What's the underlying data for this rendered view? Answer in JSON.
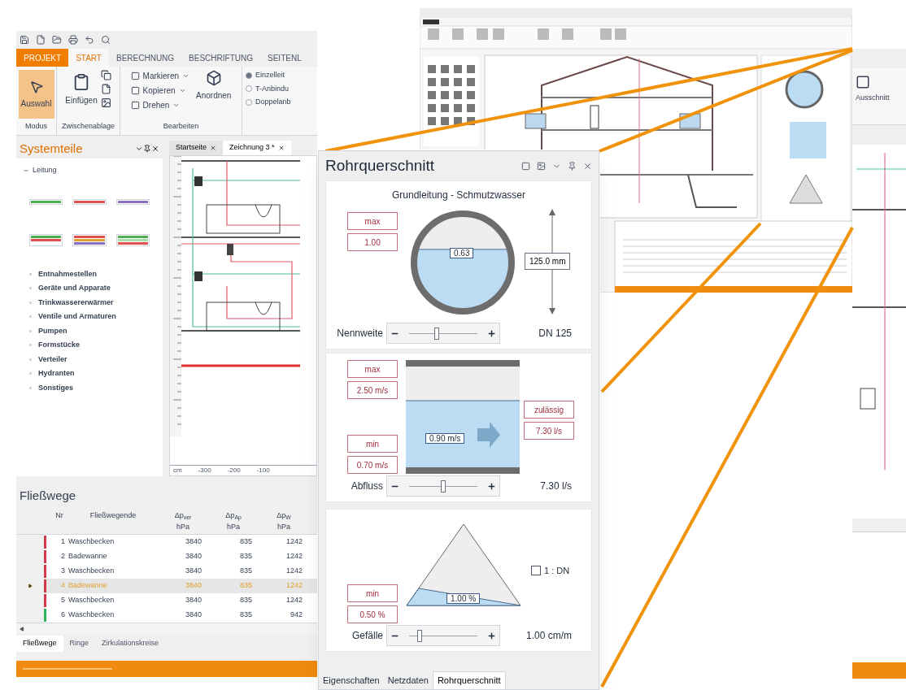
{
  "left_window": {
    "ribbon_tabs": [
      {
        "label": "PROJEKT",
        "kind": "file",
        "selected": false
      },
      {
        "label": "START",
        "kind": "tab",
        "selected": true
      },
      {
        "label": "BERECHNUNG",
        "kind": "tab",
        "selected": false
      },
      {
        "label": "BESCHRIFTUNG",
        "kind": "tab",
        "selected": false
      },
      {
        "label": "SEITENL",
        "kind": "tab",
        "selected": false
      }
    ],
    "modus": {
      "group": "Modus",
      "button": "Auswahl",
      "selected": true
    },
    "clipboard": {
      "group": "Zwischenablage",
      "button": "Einfügen"
    },
    "edit": {
      "group": "Bearbeiten",
      "items": [
        "Markieren",
        "Kopieren",
        "Drehen"
      ],
      "arrange": "Anordnen"
    },
    "connections": [
      {
        "label": "Einzelleit",
        "selected": true
      },
      {
        "label": "T-Anbindu",
        "selected": false
      },
      {
        "label": "Doppelanb",
        "selected": false
      }
    ],
    "sidebar": {
      "title": "Systemteile",
      "root": {
        "label": "Leitung",
        "expanded": true
      },
      "pipe_swatches": [
        {
          "stripes": [
            {
              "color": "#4caf50"
            }
          ]
        },
        {
          "stripes": [
            {
              "color": "#e05050"
            }
          ]
        },
        {
          "stripes": [
            {
              "color": "#8a6fc0"
            }
          ]
        },
        {
          "stripes": [
            {
              "color": "#4caf50"
            },
            {
              "color": "#e05050"
            }
          ]
        },
        {
          "stripes": [
            {
              "color": "#e05050"
            },
            {
              "color": "#e0a030"
            },
            {
              "color": "#8a6fc0"
            }
          ]
        },
        {
          "stripes": [
            {
              "color": "#4caf50"
            },
            {
              "color": "#a8e0a8"
            },
            {
              "color": "#e05050"
            }
          ]
        }
      ],
      "categories": [
        "Entnahmestellen",
        "Geräte und Apparate",
        "Trinkwassererwärmer",
        "Ventile und Armaturen",
        "Pumpen",
        "Formstücke",
        "Verteiler",
        "Hydranten",
        "Sonstiges"
      ]
    },
    "doc_tabs": [
      {
        "label": "Startseite",
        "selected": false
      },
      {
        "label": "Zeichnung 3 *",
        "selected": true
      }
    ],
    "ruler": {
      "unit": "cm",
      "labels": [
        "-300",
        "-200",
        "-100"
      ]
    },
    "table": {
      "title": "Fließwege",
      "columns": [
        {
          "name": "Nr"
        },
        {
          "name": "Fließwegende"
        },
        {
          "name": "Δp$_{ver}$",
          "unit": "hPa"
        },
        {
          "name": "Δp$_{Ap}$",
          "unit": "hPa"
        },
        {
          "name": "Δp$_{W}$",
          "unit": "hPa"
        }
      ],
      "rows": [
        {
          "cells": [
            "1",
            "Waschbecken",
            "3840",
            "835",
            "1242"
          ],
          "color": "#d0384c",
          "selected": false
        },
        {
          "cells": [
            "2",
            "Badewanne",
            "3840",
            "835",
            "1242"
          ],
          "color": "#d0384c",
          "selected": false
        },
        {
          "cells": [
            "3",
            "Waschbecken",
            "3840",
            "835",
            "1242"
          ],
          "color": "#d0384c",
          "selected": false
        },
        {
          "cells": [
            "4",
            "Badewanne",
            "3840",
            "835",
            "1242"
          ],
          "color": "#d0384c",
          "selected": true
        },
        {
          "cells": [
            "5",
            "Waschbecken",
            "3840",
            "835",
            "1242"
          ],
          "color": "#d0384c",
          "selected": false
        },
        {
          "cells": [
            "6",
            "Waschbecken",
            "3840",
            "835",
            "942"
          ],
          "color": "#2fb35a",
          "selected": false
        }
      ]
    },
    "bottom_tabs": [
      {
        "label": "Fließwege",
        "selected": true
      },
      {
        "label": "Ringe",
        "selected": false
      },
      {
        "label": "Zirkulationskreise",
        "selected": false
      }
    ]
  },
  "right_window": {
    "ribbon_button": "Ausschnitt"
  },
  "panel": {
    "title": "Rohrquerschnitt",
    "cross_section": {
      "title": "Grundleitung - Schmutzwasser",
      "limit_label": "max",
      "limit_value": "1.00",
      "fill_label": "0.63",
      "diameter": "125.0 mm",
      "slider": {
        "label": "Nennweite",
        "level": 0.4,
        "value": "DN 125"
      }
    },
    "flow": {
      "max_label": "max",
      "max_value": "2.50 m/s",
      "min_label": "min",
      "min_value": "0.70 m/s",
      "allowed_label": "zulässig",
      "allowed_value": "7.30 l/s",
      "velocity": "0.90 m/s",
      "slider": {
        "label": "Abfluss",
        "level": 0.5,
        "value": "7.30 l/s"
      }
    },
    "slope": {
      "min_label": "min",
      "min_value": "0.50 %",
      "slope_label": "1.00 %",
      "checkbox": {
        "label": "1 : DN",
        "checked": false
      },
      "slider": {
        "label": "Gefälle",
        "level": 0.15,
        "value": "1.00 cm/m"
      }
    },
    "tabs": [
      {
        "label": "Eigenschaften",
        "selected": false
      },
      {
        "label": "Netzdaten",
        "selected": false
      },
      {
        "label": "Rohrquerschnitt",
        "selected": true
      }
    ]
  }
}
